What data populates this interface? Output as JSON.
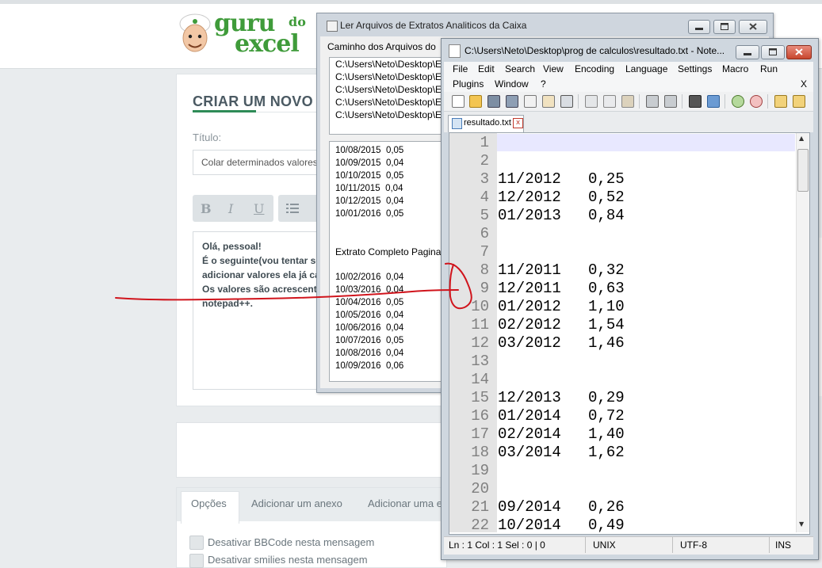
{
  "forum": {
    "heading": "CRIAR UM NOVO",
    "title_label": "Título:",
    "title_value": "Colar determinados valores",
    "format_bold": "B",
    "format_italic": "I",
    "format_underline": "U",
    "message_lines": [
      "Olá, pessoal!",
      "É o seguinte(vou tentar ser",
      "adicionar valores ela já ca",
      "Os valores são acrescentad",
      "notepad++."
    ],
    "tabs": [
      "Opções",
      "Adicionar um anexo",
      "Adicionar uma e"
    ],
    "options": [
      "Desativar BBCode nesta mensagem",
      "Desativar smilies nesta mensagem"
    ]
  },
  "reader_window": {
    "title": "Ler Arquivos de Extratos Analiticos da Caixa",
    "paths_label": "Caminho dos Arquivos do",
    "paths": [
      "C:\\Users\\Neto\\Desktop\\E",
      "C:\\Users\\Neto\\Desktop\\E",
      "C:\\Users\\Neto\\Desktop\\E",
      "C:\\Users\\Neto\\Desktop\\E",
      "C:\\Users\\Neto\\Desktop\\E"
    ],
    "extract_lines_a": [
      "10/08/2015  0,05",
      "10/09/2015  0,04",
      "10/10/2015  0,05",
      "10/11/2015  0,04",
      "10/12/2015  0,04",
      "10/01/2016  0,05"
    ],
    "extract_heading": "Extrato Completo Pagina",
    "extract_lines_b": [
      "10/02/2016  0,04",
      "10/03/2016  0,04",
      "10/04/2016  0,05",
      "10/05/2016  0,04",
      "10/06/2016  0,04",
      "10/07/2016  0,05",
      "10/08/2016  0,04",
      "10/09/2016  0,06"
    ]
  },
  "notepad": {
    "title": "C:\\Users\\Neto\\Desktop\\prog de calculos\\resultado.txt - Note...",
    "menu_row1": [
      "File",
      "Edit",
      "Search",
      "View",
      "Encoding",
      "Language",
      "Settings",
      "Macro",
      "Run"
    ],
    "menu_row2": [
      "Plugins",
      "Window",
      "?"
    ],
    "menu_close": "X",
    "tab_label": "resultado.txt",
    "tab_close": "x",
    "lines": [
      {
        "n": "1",
        "text": ""
      },
      {
        "n": "2",
        "text": ""
      },
      {
        "n": "3",
        "text": "11/2012   0,25"
      },
      {
        "n": "4",
        "text": "12/2012   0,52"
      },
      {
        "n": "5",
        "text": "01/2013   0,84"
      },
      {
        "n": "6",
        "text": ""
      },
      {
        "n": "7",
        "text": ""
      },
      {
        "n": "8",
        "text": "11/2011   0,32"
      },
      {
        "n": "9",
        "text": "12/2011   0,63"
      },
      {
        "n": "10",
        "text": "01/2012   1,10"
      },
      {
        "n": "11",
        "text": "02/2012   1,54"
      },
      {
        "n": "12",
        "text": "03/2012   1,46"
      },
      {
        "n": "13",
        "text": ""
      },
      {
        "n": "14",
        "text": ""
      },
      {
        "n": "15",
        "text": "12/2013   0,29"
      },
      {
        "n": "16",
        "text": "01/2014   0,72"
      },
      {
        "n": "17",
        "text": "02/2014   1,40"
      },
      {
        "n": "18",
        "text": "03/2014   1,62"
      },
      {
        "n": "19",
        "text": ""
      },
      {
        "n": "20",
        "text": ""
      },
      {
        "n": "21",
        "text": "09/2014   0,26"
      },
      {
        "n": "22",
        "text": "10/2014   0,49"
      }
    ],
    "status": {
      "position": "Ln : 1    Col : 1    Sel : 0 | 0",
      "eol": "UNIX",
      "encoding": "UTF-8",
      "mode": "INS"
    }
  },
  "colors": {
    "brand_green": "#3f9b3a",
    "annotation_red": "#d0141c"
  }
}
